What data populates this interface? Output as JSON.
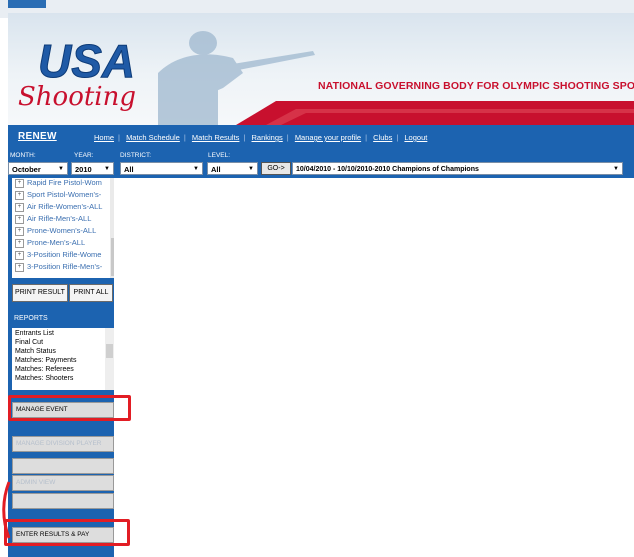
{
  "banner": {
    "logo_top": "USA",
    "logo_script": "Shooting",
    "tagline": "NATIONAL GOVERNING BODY FOR OLYMPIC SHOOTING SPORTS"
  },
  "nav": {
    "renew": "RENEW",
    "links": [
      "Home",
      "Match Schedule",
      "Match Results",
      "Rankings",
      "Manage your profile",
      "Clubs",
      "Logout"
    ]
  },
  "filters": {
    "month_label": "MONTH:",
    "month_value": "October",
    "year_label": "YEAR:",
    "year_value": "2010",
    "district_label": "DISTRICT:",
    "district_value": "All",
    "level_label": "LEVEL:",
    "level_value": "All",
    "go_label": "GO->",
    "event_value": "10/04/2010 - 10/10/2010-2010 Champions of Champions"
  },
  "tree_items": [
    "Rapid Fire Pistol-Wom",
    "Sport Pistol-Women's-",
    "Air Rifle-Women's-ALL",
    "Air Rifle-Men's-ALL",
    "Prone-Women's-ALL",
    "Prone-Men's-ALL",
    "3-Position Rifle-Wome",
    "3-Position Rifle-Men's-"
  ],
  "buttons": {
    "print_result": "PRINT RESULT",
    "print_all": "PRINT ALL",
    "manage_event": "MANAGE EVENT",
    "manage_division": "MANAGE DIVISION PLAYER",
    "admin_view": "ADMIN VIEW",
    "enter_results": "ENTER RESULTS & PAY"
  },
  "reports": {
    "label": "REPORTS",
    "items": [
      "Entrants List",
      "Final Cut",
      "Match Status",
      "Matches: Payments",
      "Matches: Referees",
      "Matches: Shooters"
    ]
  },
  "colors": {
    "brand_blue": "#1c63b0",
    "brand_red": "#c8102e",
    "highlight_red": "#e21d24"
  }
}
